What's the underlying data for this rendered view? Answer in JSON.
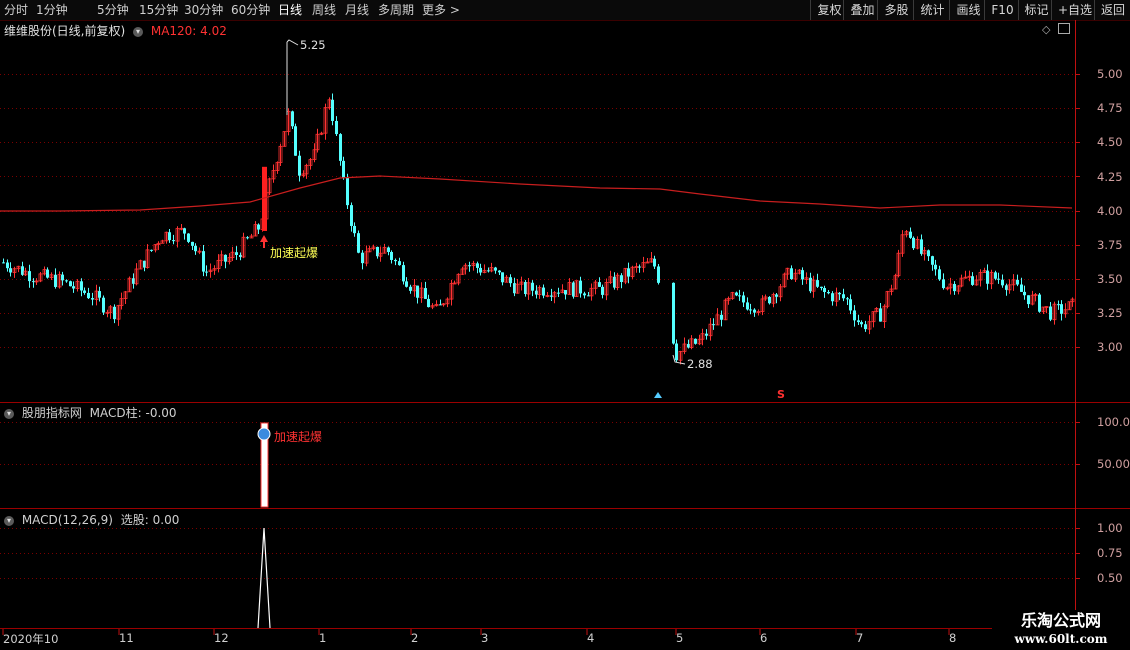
{
  "toolbar": {
    "periods": [
      {
        "label": "分时",
        "active": false
      },
      {
        "label": "1分钟",
        "active": false
      },
      {
        "label": "5分钟",
        "active": false
      },
      {
        "label": "15分钟",
        "active": false
      },
      {
        "label": "30分钟",
        "active": false
      },
      {
        "label": "60分钟",
        "active": false
      },
      {
        "label": "日线",
        "active": true
      },
      {
        "label": "周线",
        "active": false
      },
      {
        "label": "月线",
        "active": false
      },
      {
        "label": "多周期",
        "active": false
      },
      {
        "label": "更多",
        "active": false
      }
    ],
    "right_buttons": [
      "复权",
      "叠加",
      "多股",
      "统计",
      "画线",
      "F10",
      "标记",
      "+自选",
      "返回"
    ]
  },
  "main_panel": {
    "title": "维维股份(日线,前复权)",
    "ma_label": "MA120: 4.02",
    "high_label": "5.25",
    "low_label": "2.88",
    "signal_label": "加速起爆",
    "marker_s": "S",
    "y_ticks": [
      "5.00",
      "4.75",
      "4.50",
      "4.25",
      "4.00",
      "3.75",
      "3.50",
      "3.25",
      "3.00"
    ]
  },
  "indicator_panel": {
    "title": "股朋指标网",
    "value_label": "MACD柱: -0.00",
    "signal_label": "加速起爆",
    "y_ticks": [
      "100.0",
      "50.00"
    ]
  },
  "macd_panel": {
    "title": "MACD(12,26,9)",
    "value_label": "选股: 0.00",
    "y_ticks": [
      "1.00",
      "0.75",
      "0.50"
    ]
  },
  "date_axis": [
    "2020年10",
    "11",
    "12",
    "1",
    "2",
    "3",
    "4",
    "5",
    "6",
    "7",
    "8"
  ],
  "watermark": {
    "line1": "乐淘公式网",
    "line2": "www.60lt.com"
  },
  "colors": {
    "up": "#ff3232",
    "down": "#54ffff",
    "ma": "#c81e1e",
    "grid": "#7a0000",
    "axis": "#ff2020",
    "accent": "#ffff55"
  }
}
